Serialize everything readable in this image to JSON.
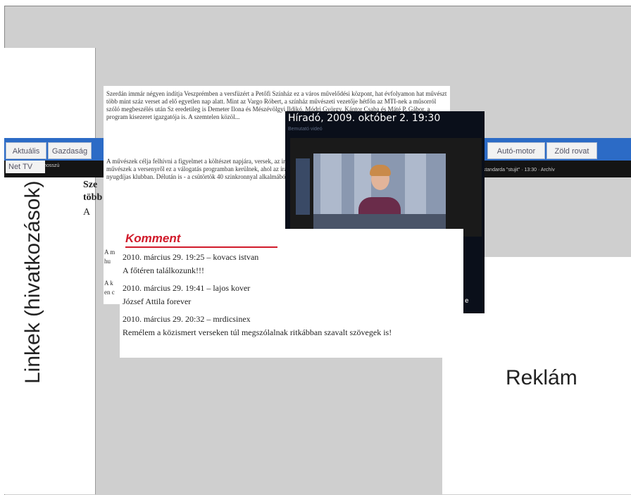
{
  "left_sidebar": {
    "label": "Linkek (hivatkozások)"
  },
  "right_ad": {
    "label": "Reklám"
  },
  "nav": {
    "tabs": [
      "Aktuális",
      "Gazdaság",
      "Autó-motor",
      "Zöld rovat"
    ],
    "sub_tab": "Net TV",
    "sub_left": "Nagyon hosszú",
    "sub_right": "n standarda \"stujit\" · 13:30 · Archív"
  },
  "article": {
    "paragraphs": [
      "Szerdán immár négyen indítja Veszprémben a versfüzért a Petőfi Színház ez a város művelődési központ, hat évfolyamon hat művészt több mint száz verset ad elő egyetlen nap alatt. Mint az Vargo Róbert, a színház művészeti vezetője hétfőn az MTI-nek a műsorról szóló megbeszélés után Sz eredetileg is Demeter Ilona és Mészévölgyi Ildikó, Módri György, Kántor Csaba és Máté P. Gábor, a program kisezeret igazgatója is. A szemtelen közöl...",
      "A művészek célja felhívni a figyelmet a költészet napjára, versek, az irodalom népszerűsítése, a magyar kultúra... Vargo Róbert. A művészek a versenyről ez a válogatás programban kerülnek, ahol az irányítóknak verseket mondanak, általános iskolában és egy nyugdíjas klubban. Délután is - a csütörtök 40 szinkronnyal alkalmából a... hozz..."
    ],
    "heading_1": "Sze",
    "heading_2": "több",
    "heading_3": "A",
    "side_1": "A m",
    "side_2": "hu",
    "side_3": "A k",
    "side_4": "en c"
  },
  "tv": {
    "title": "Híradó, 2009. október 2. 19:30",
    "subtitle": "Bemutató videó",
    "bottom_label": "e"
  },
  "comments": {
    "title": "Komment",
    "items": [
      {
        "meta": "2010. március 29. 19:25 – kovacs istvan",
        "text": "A főtéren találkozunk!!!"
      },
      {
        "meta": "2010. március 29. 19:41 – lajos kover",
        "text": "József Attila forever"
      },
      {
        "meta": "2010. március 29. 20:32 – mrdicsinex",
        "text": "Remélem a közismert verseken túl megszólalnak ritkábban szavalt szövegek is!"
      }
    ]
  }
}
